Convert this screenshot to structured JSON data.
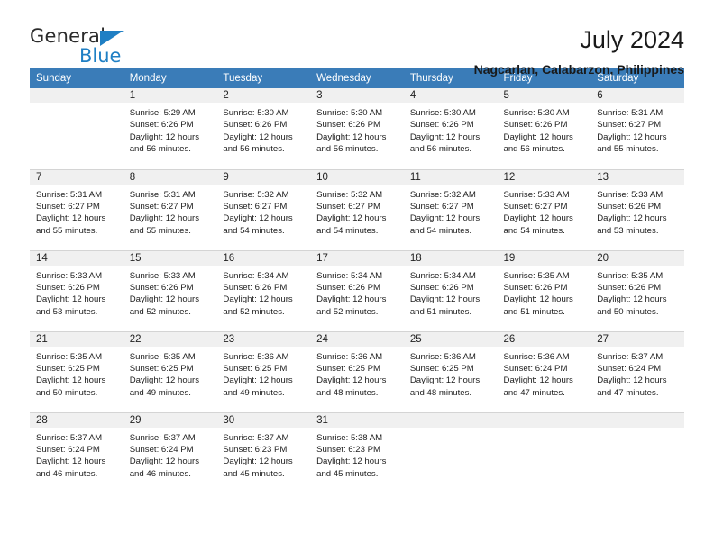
{
  "brand": {
    "name_part1": "General",
    "name_part2": "Blue",
    "accent_color": "#1f7fc4"
  },
  "header": {
    "title": "July 2024",
    "subtitle": "Nagcarlan, Calabarzon, Philippines"
  },
  "calendar": {
    "header_bg": "#3a7cb8",
    "daynum_bg": "#f0f0f0",
    "weekday_labels": [
      "Sunday",
      "Monday",
      "Tuesday",
      "Wednesday",
      "Thursday",
      "Friday",
      "Saturday"
    ],
    "weeks": [
      [
        {
          "day": "",
          "sunrise": "",
          "sunset": "",
          "daylight_line1": "",
          "daylight_line2": ""
        },
        {
          "day": "1",
          "sunrise": "Sunrise: 5:29 AM",
          "sunset": "Sunset: 6:26 PM",
          "daylight_line1": "Daylight: 12 hours",
          "daylight_line2": "and 56 minutes."
        },
        {
          "day": "2",
          "sunrise": "Sunrise: 5:30 AM",
          "sunset": "Sunset: 6:26 PM",
          "daylight_line1": "Daylight: 12 hours",
          "daylight_line2": "and 56 minutes."
        },
        {
          "day": "3",
          "sunrise": "Sunrise: 5:30 AM",
          "sunset": "Sunset: 6:26 PM",
          "daylight_line1": "Daylight: 12 hours",
          "daylight_line2": "and 56 minutes."
        },
        {
          "day": "4",
          "sunrise": "Sunrise: 5:30 AM",
          "sunset": "Sunset: 6:26 PM",
          "daylight_line1": "Daylight: 12 hours",
          "daylight_line2": "and 56 minutes."
        },
        {
          "day": "5",
          "sunrise": "Sunrise: 5:30 AM",
          "sunset": "Sunset: 6:26 PM",
          "daylight_line1": "Daylight: 12 hours",
          "daylight_line2": "and 56 minutes."
        },
        {
          "day": "6",
          "sunrise": "Sunrise: 5:31 AM",
          "sunset": "Sunset: 6:27 PM",
          "daylight_line1": "Daylight: 12 hours",
          "daylight_line2": "and 55 minutes."
        }
      ],
      [
        {
          "day": "7",
          "sunrise": "Sunrise: 5:31 AM",
          "sunset": "Sunset: 6:27 PM",
          "daylight_line1": "Daylight: 12 hours",
          "daylight_line2": "and 55 minutes."
        },
        {
          "day": "8",
          "sunrise": "Sunrise: 5:31 AM",
          "sunset": "Sunset: 6:27 PM",
          "daylight_line1": "Daylight: 12 hours",
          "daylight_line2": "and 55 minutes."
        },
        {
          "day": "9",
          "sunrise": "Sunrise: 5:32 AM",
          "sunset": "Sunset: 6:27 PM",
          "daylight_line1": "Daylight: 12 hours",
          "daylight_line2": "and 54 minutes."
        },
        {
          "day": "10",
          "sunrise": "Sunrise: 5:32 AM",
          "sunset": "Sunset: 6:27 PM",
          "daylight_line1": "Daylight: 12 hours",
          "daylight_line2": "and 54 minutes."
        },
        {
          "day": "11",
          "sunrise": "Sunrise: 5:32 AM",
          "sunset": "Sunset: 6:27 PM",
          "daylight_line1": "Daylight: 12 hours",
          "daylight_line2": "and 54 minutes."
        },
        {
          "day": "12",
          "sunrise": "Sunrise: 5:33 AM",
          "sunset": "Sunset: 6:27 PM",
          "daylight_line1": "Daylight: 12 hours",
          "daylight_line2": "and 54 minutes."
        },
        {
          "day": "13",
          "sunrise": "Sunrise: 5:33 AM",
          "sunset": "Sunset: 6:26 PM",
          "daylight_line1": "Daylight: 12 hours",
          "daylight_line2": "and 53 minutes."
        }
      ],
      [
        {
          "day": "14",
          "sunrise": "Sunrise: 5:33 AM",
          "sunset": "Sunset: 6:26 PM",
          "daylight_line1": "Daylight: 12 hours",
          "daylight_line2": "and 53 minutes."
        },
        {
          "day": "15",
          "sunrise": "Sunrise: 5:33 AM",
          "sunset": "Sunset: 6:26 PM",
          "daylight_line1": "Daylight: 12 hours",
          "daylight_line2": "and 52 minutes."
        },
        {
          "day": "16",
          "sunrise": "Sunrise: 5:34 AM",
          "sunset": "Sunset: 6:26 PM",
          "daylight_line1": "Daylight: 12 hours",
          "daylight_line2": "and 52 minutes."
        },
        {
          "day": "17",
          "sunrise": "Sunrise: 5:34 AM",
          "sunset": "Sunset: 6:26 PM",
          "daylight_line1": "Daylight: 12 hours",
          "daylight_line2": "and 52 minutes."
        },
        {
          "day": "18",
          "sunrise": "Sunrise: 5:34 AM",
          "sunset": "Sunset: 6:26 PM",
          "daylight_line1": "Daylight: 12 hours",
          "daylight_line2": "and 51 minutes."
        },
        {
          "day": "19",
          "sunrise": "Sunrise: 5:35 AM",
          "sunset": "Sunset: 6:26 PM",
          "daylight_line1": "Daylight: 12 hours",
          "daylight_line2": "and 51 minutes."
        },
        {
          "day": "20",
          "sunrise": "Sunrise: 5:35 AM",
          "sunset": "Sunset: 6:26 PM",
          "daylight_line1": "Daylight: 12 hours",
          "daylight_line2": "and 50 minutes."
        }
      ],
      [
        {
          "day": "21",
          "sunrise": "Sunrise: 5:35 AM",
          "sunset": "Sunset: 6:25 PM",
          "daylight_line1": "Daylight: 12 hours",
          "daylight_line2": "and 50 minutes."
        },
        {
          "day": "22",
          "sunrise": "Sunrise: 5:35 AM",
          "sunset": "Sunset: 6:25 PM",
          "daylight_line1": "Daylight: 12 hours",
          "daylight_line2": "and 49 minutes."
        },
        {
          "day": "23",
          "sunrise": "Sunrise: 5:36 AM",
          "sunset": "Sunset: 6:25 PM",
          "daylight_line1": "Daylight: 12 hours",
          "daylight_line2": "and 49 minutes."
        },
        {
          "day": "24",
          "sunrise": "Sunrise: 5:36 AM",
          "sunset": "Sunset: 6:25 PM",
          "daylight_line1": "Daylight: 12 hours",
          "daylight_line2": "and 48 minutes."
        },
        {
          "day": "25",
          "sunrise": "Sunrise: 5:36 AM",
          "sunset": "Sunset: 6:25 PM",
          "daylight_line1": "Daylight: 12 hours",
          "daylight_line2": "and 48 minutes."
        },
        {
          "day": "26",
          "sunrise": "Sunrise: 5:36 AM",
          "sunset": "Sunset: 6:24 PM",
          "daylight_line1": "Daylight: 12 hours",
          "daylight_line2": "and 47 minutes."
        },
        {
          "day": "27",
          "sunrise": "Sunrise: 5:37 AM",
          "sunset": "Sunset: 6:24 PM",
          "daylight_line1": "Daylight: 12 hours",
          "daylight_line2": "and 47 minutes."
        }
      ],
      [
        {
          "day": "28",
          "sunrise": "Sunrise: 5:37 AM",
          "sunset": "Sunset: 6:24 PM",
          "daylight_line1": "Daylight: 12 hours",
          "daylight_line2": "and 46 minutes."
        },
        {
          "day": "29",
          "sunrise": "Sunrise: 5:37 AM",
          "sunset": "Sunset: 6:24 PM",
          "daylight_line1": "Daylight: 12 hours",
          "daylight_line2": "and 46 minutes."
        },
        {
          "day": "30",
          "sunrise": "Sunrise: 5:37 AM",
          "sunset": "Sunset: 6:23 PM",
          "daylight_line1": "Daylight: 12 hours",
          "daylight_line2": "and 45 minutes."
        },
        {
          "day": "31",
          "sunrise": "Sunrise: 5:38 AM",
          "sunset": "Sunset: 6:23 PM",
          "daylight_line1": "Daylight: 12 hours",
          "daylight_line2": "and 45 minutes."
        },
        {
          "day": "",
          "sunrise": "",
          "sunset": "",
          "daylight_line1": "",
          "daylight_line2": ""
        },
        {
          "day": "",
          "sunrise": "",
          "sunset": "",
          "daylight_line1": "",
          "daylight_line2": ""
        },
        {
          "day": "",
          "sunrise": "",
          "sunset": "",
          "daylight_line1": "",
          "daylight_line2": ""
        }
      ]
    ]
  }
}
